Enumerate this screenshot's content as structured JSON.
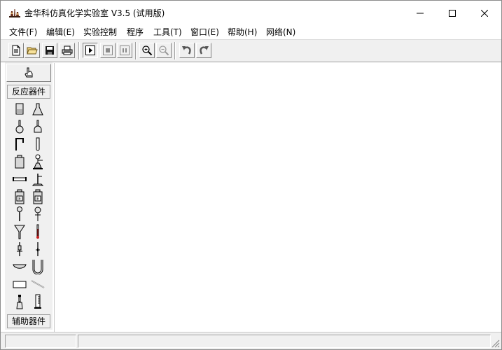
{
  "window": {
    "title": "金华科仿真化学实验室 V3.5  (试用版)",
    "app_icon": "lab-apparatus-icon",
    "minimize_icon": "minimize-icon",
    "maximize_icon": "maximize-icon",
    "close_icon": "close-icon"
  },
  "menu": {
    "items": [
      {
        "label": "文件(F)"
      },
      {
        "label": "编辑(E)"
      },
      {
        "label": "实验控制"
      },
      {
        "label": "程序"
      },
      {
        "label": "工具(T)"
      },
      {
        "label": "窗口(E)"
      },
      {
        "label": "帮助(H)"
      },
      {
        "label": "网络(N)"
      }
    ]
  },
  "toolbar": {
    "buttons": [
      {
        "icon": "new-file-icon"
      },
      {
        "icon": "open-folder-icon"
      },
      {
        "icon": "save-icon"
      },
      {
        "icon": "print-icon"
      },
      {
        "icon": "play-icon"
      },
      {
        "icon": "stop-icon"
      },
      {
        "icon": "pause-icon"
      },
      {
        "icon": "zoom-in-icon"
      },
      {
        "icon": "zoom-out-icon"
      },
      {
        "icon": "undo-icon"
      },
      {
        "icon": "redo-icon"
      }
    ]
  },
  "palette": {
    "pointer_icon": "pointer-hand-icon",
    "group_reaction": "反应器件",
    "group_auxiliary": "辅助器件",
    "tools": [
      "beaker-icon",
      "conical-flask-icon",
      "round-flask-icon",
      "flat-flask-icon",
      "bent-tube-icon",
      "test-tube-icon",
      "gas-bottle-icon",
      "alcohol-lamp-stand-icon",
      "horizontal-tube-icon",
      "iron-stand-icon",
      "reagent-bottle-icon",
      "reagent-bottle-2-icon",
      "dropper-icon",
      "separatory-funnel-icon",
      "funnel-icon",
      "thermometer-icon",
      "pipette-icon",
      "burette-icon",
      "evaporating-dish-icon",
      "u-tube-icon",
      "trough-icon",
      "glass-rod-icon",
      "distilling-flask-icon",
      "graduated-cylinder-icon"
    ]
  },
  "status": {
    "pane1": "",
    "pane2": ""
  }
}
